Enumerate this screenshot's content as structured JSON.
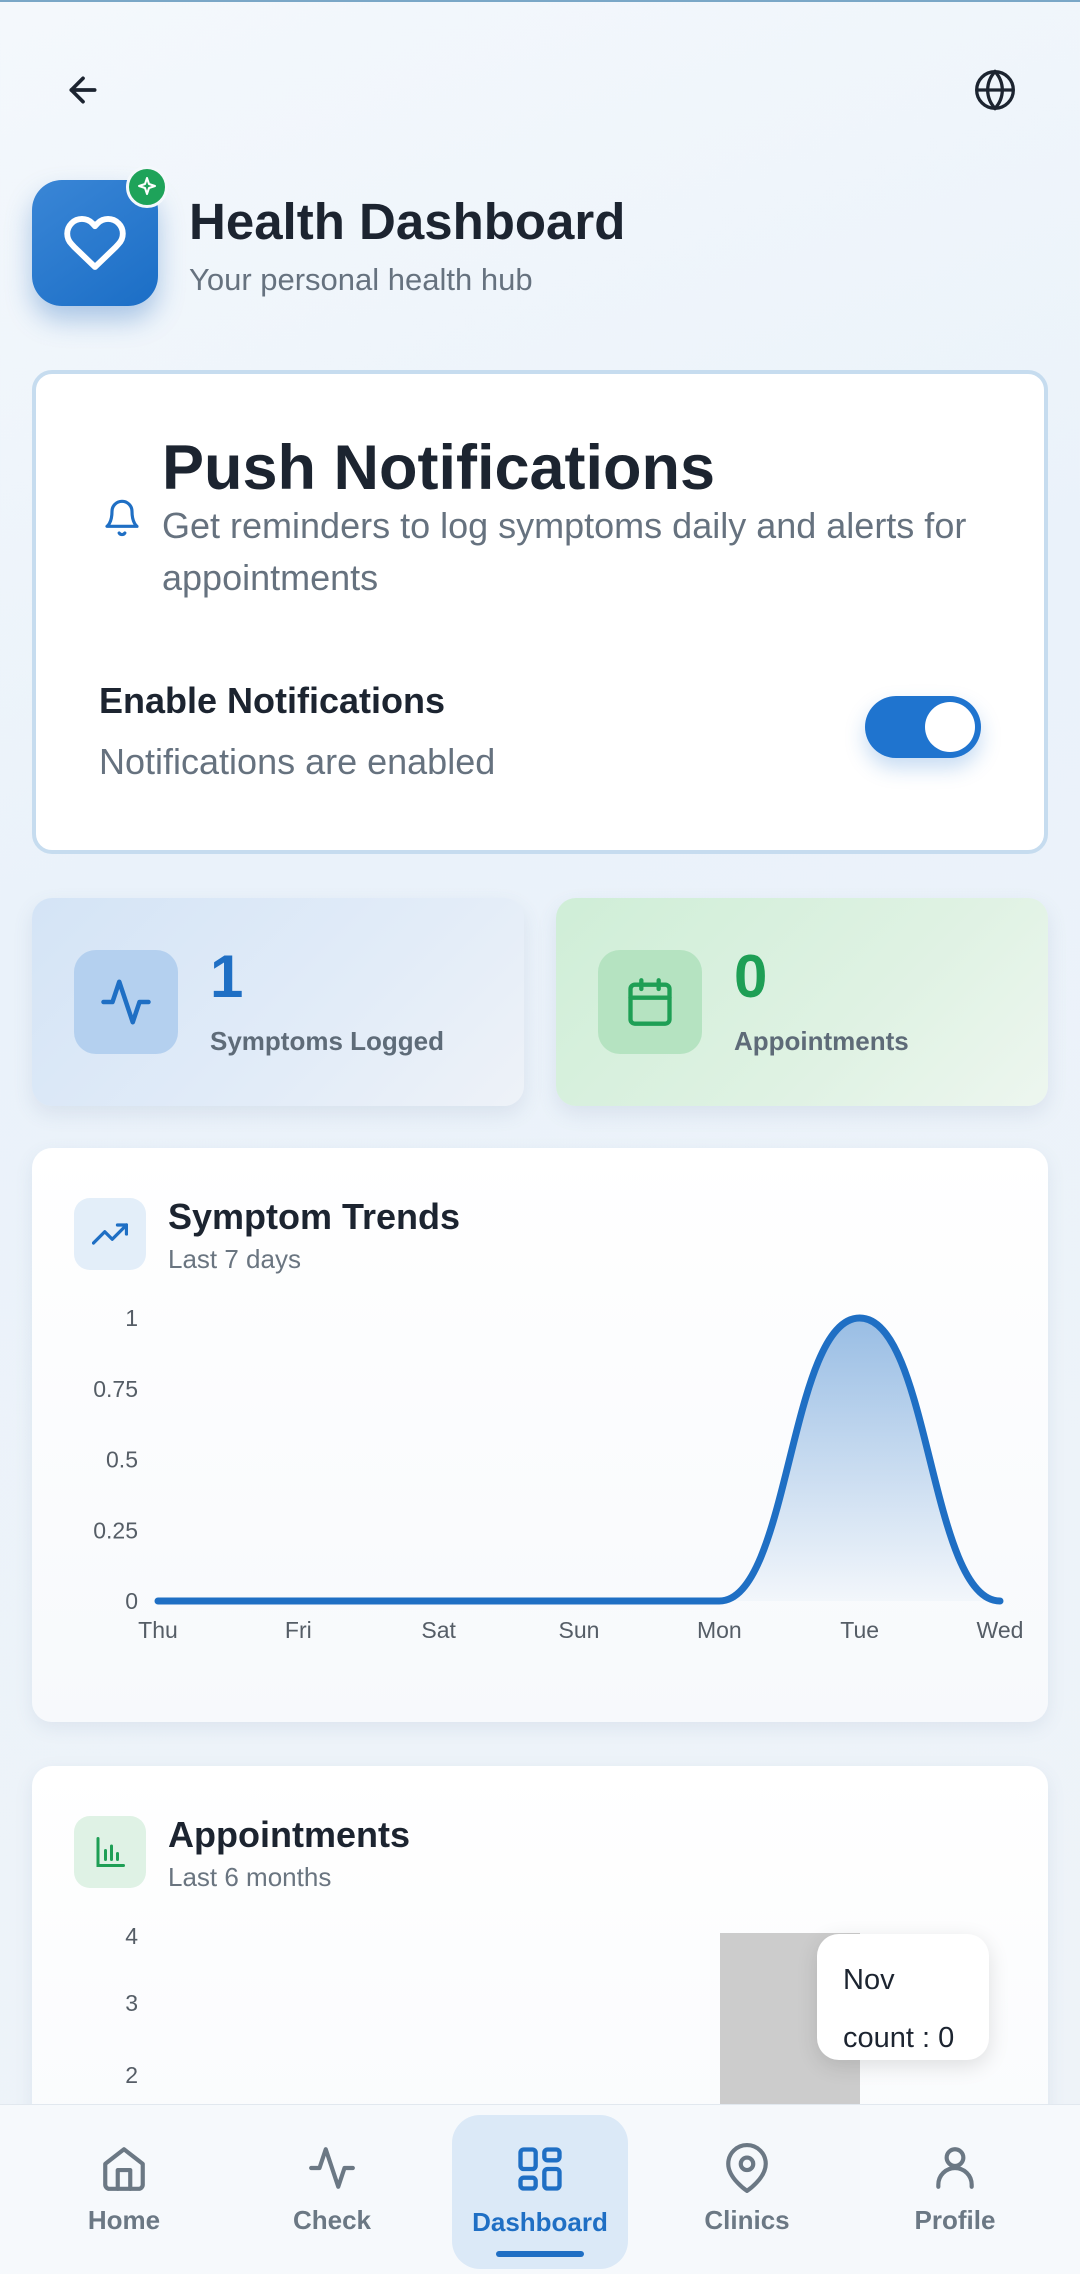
{
  "header": {
    "title": "Health Dashboard",
    "subtitle": "Your personal health hub"
  },
  "notifications": {
    "title": "Push Notifications",
    "description": "Get reminders to log symptoms daily and alerts for appointments",
    "enable_label": "Enable Notifications",
    "status_text": "Notifications are enabled",
    "enabled": true
  },
  "stats": [
    {
      "value": "1",
      "label": "Symptoms Logged",
      "icon": "activity-icon"
    },
    {
      "value": "0",
      "label": "Appointments",
      "icon": "calendar-icon"
    }
  ],
  "symptom_trends": {
    "title": "Symptom Trends",
    "subtitle": "Last 7 days"
  },
  "appointments_chart": {
    "title": "Appointments",
    "subtitle": "Last 6 months",
    "tooltip": {
      "label": "Nov",
      "value_text": "count : 0"
    }
  },
  "chart_data": [
    {
      "type": "area",
      "categories": [
        "Thu",
        "Fri",
        "Sat",
        "Sun",
        "Mon",
        "Tue",
        "Wed"
      ],
      "series": [
        {
          "values": [
            0,
            0,
            0,
            0,
            0,
            1,
            0
          ]
        }
      ],
      "y_ticks": [
        "0",
        "0.25",
        "0.5",
        "0.75",
        "1"
      ],
      "ylim": [
        0,
        1
      ],
      "color": "#1f6fc4",
      "grid": false
    },
    {
      "type": "bar",
      "y_ticks": [
        "2",
        "3",
        "4"
      ],
      "visible_category": "Nov",
      "visible_value": 0,
      "grid": false
    }
  ],
  "nav": {
    "active": "Dashboard",
    "items": [
      {
        "label": "Home",
        "icon": "home-icon"
      },
      {
        "label": "Check",
        "icon": "activity-icon"
      },
      {
        "label": "Dashboard",
        "icon": "dashboard-grid-icon"
      },
      {
        "label": "Clinics",
        "icon": "map-pin-icon"
      },
      {
        "label": "Profile",
        "icon": "user-icon"
      }
    ]
  },
  "colors": {
    "primary": "#1f6fc4",
    "success": "#1ea35a",
    "text": "#1c2430",
    "muted": "#66727f"
  }
}
